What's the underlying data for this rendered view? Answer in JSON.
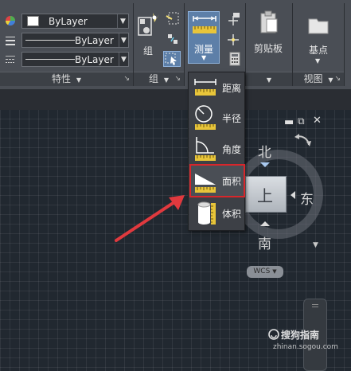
{
  "properties_panel": {
    "color_value": "ByLayer",
    "linetype_value": "ByLayer",
    "lineweight_value": "ByLayer",
    "title": "特性"
  },
  "groups_panel": {
    "group_label": "组",
    "title": "组"
  },
  "measure_panel": {
    "measure_label": "测量"
  },
  "clipboard_panel": {
    "paste_label": "剪贴板"
  },
  "base_panel": {
    "base_label": "基点"
  },
  "view_panel": {
    "title": "视图"
  },
  "measure_menu": {
    "items": [
      {
        "label": "距离",
        "icon": "distance-icon"
      },
      {
        "label": "半径",
        "icon": "radius-icon"
      },
      {
        "label": "角度",
        "icon": "angle-icon"
      },
      {
        "label": "面积",
        "icon": "area-icon"
      },
      {
        "label": "体积",
        "icon": "volume-icon"
      }
    ]
  },
  "viewcube": {
    "north": "北",
    "east": "东",
    "south": "南",
    "top_face": "上"
  },
  "wcs_label": "WCS",
  "watermark": {
    "main": "搜狗指南",
    "sub": "zhinan.sogou.com"
  },
  "colors": {
    "highlight": "#d8262b",
    "arrow": "#e0393e",
    "ruler_yellow": "#e8c53a"
  }
}
